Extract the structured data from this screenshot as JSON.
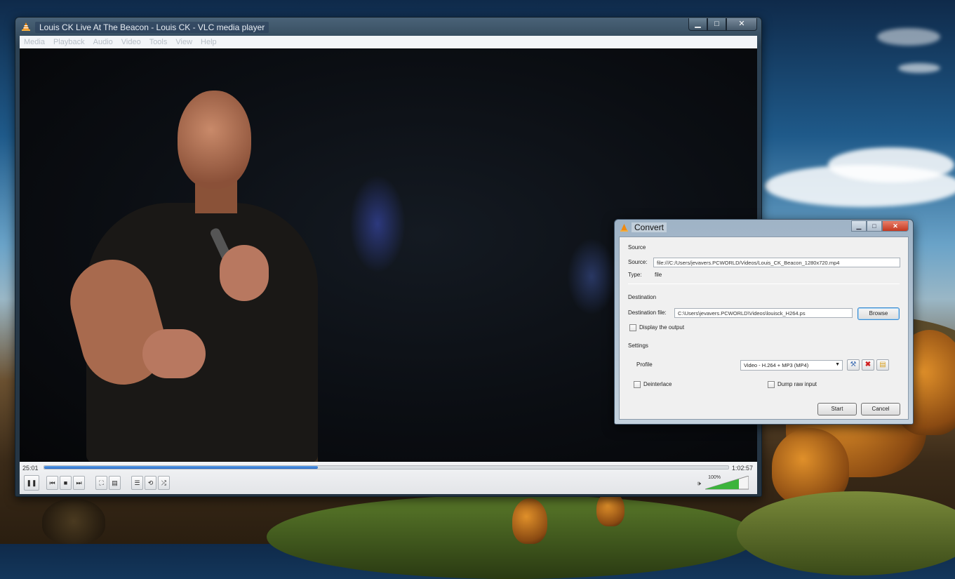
{
  "vlc": {
    "title": "Louis CK Live At The Beacon - Louis CK - VLC media player",
    "menu": [
      "Media",
      "Playback",
      "Audio",
      "Video",
      "Tools",
      "View",
      "Help"
    ],
    "time_elapsed": "25:01",
    "time_total": "1:02:57",
    "progress_fraction": 0.4,
    "volume": "100%",
    "buttons": {
      "play_pause": "❚❚",
      "prev": "⏮",
      "stop": "■",
      "next": "⏭",
      "fullscreen": "⛶",
      "extended": "▤",
      "playlist": "☰",
      "loop": "⟲",
      "random": "⤮"
    }
  },
  "convert": {
    "title": "Convert",
    "source_section": "Source",
    "source_label": "Source:",
    "source_value": "file:///C:/Users/jevavers.PCWORLD/Videos/Louis_CK_Beacon_1280x720.mp4",
    "type_label": "Type:",
    "type_value": "file",
    "destination_section": "Destination",
    "destination_label": "Destination file:",
    "destination_value": "C:\\Users\\jevavers.PCWORLD\\Videos\\louisck_H264.ps",
    "browse_label": "Browse",
    "display_output_label": "Display the output",
    "settings_section": "Settings",
    "profile_label": "Profile",
    "profile_value": "Video - H.264 + MP3 (MP4)",
    "deinterlace_label": "Deinterlace",
    "dump_raw_label": "Dump raw input",
    "start_label": "Start",
    "cancel_label": "Cancel"
  }
}
